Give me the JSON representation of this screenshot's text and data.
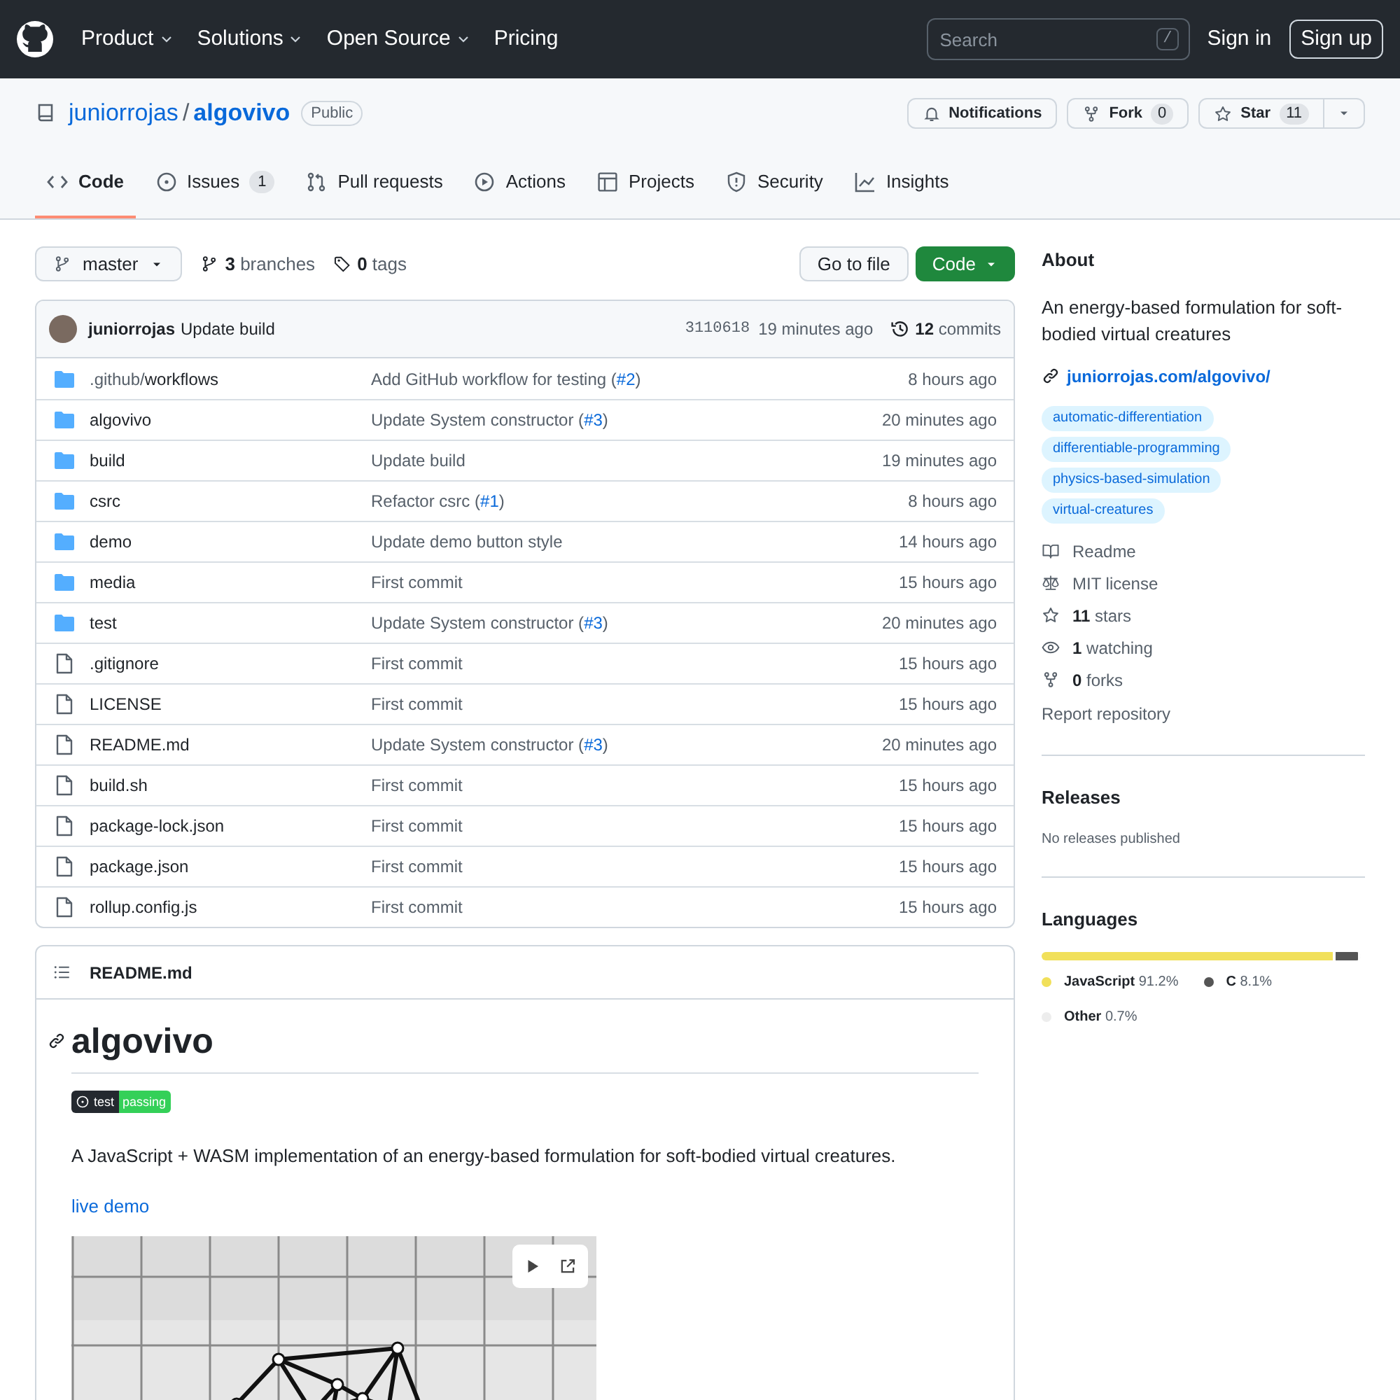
{
  "header": {
    "nav": [
      {
        "label": "Product",
        "caret": true
      },
      {
        "label": "Solutions",
        "caret": true
      },
      {
        "label": "Open Source",
        "caret": true
      },
      {
        "label": "Pricing",
        "caret": false
      }
    ],
    "search": {
      "placeholder": "Search",
      "shortcut": "/"
    },
    "sign_in": "Sign in",
    "sign_up": "Sign up"
  },
  "repo": {
    "owner": "juniorrojas",
    "separator": "/",
    "name": "algovivo",
    "visibility": "Public",
    "notifications": "Notifications",
    "fork": {
      "label": "Fork",
      "count": "0"
    },
    "star": {
      "label": "Star",
      "count": "11"
    }
  },
  "tabs": [
    {
      "kind": "code",
      "label": "Code",
      "selected": true
    },
    {
      "kind": "issues",
      "label": "Issues",
      "count": "1",
      "selected": false
    },
    {
      "kind": "pulls",
      "label": "Pull requests",
      "selected": false
    },
    {
      "kind": "actions",
      "label": "Actions",
      "selected": false
    },
    {
      "kind": "projects",
      "label": "Projects",
      "selected": false
    },
    {
      "kind": "security",
      "label": "Security",
      "selected": false
    },
    {
      "kind": "insights",
      "label": "Insights",
      "selected": false
    }
  ],
  "toolbar": {
    "branch": "master",
    "branches_count": "3",
    "branches_label": "branches",
    "tags_count": "0",
    "tags_label": "tags",
    "go_to_file": "Go to file",
    "code": "Code"
  },
  "latest_commit": {
    "author": "juniorrojas",
    "message": "Update build",
    "sha": "3110618",
    "time": "19 minutes ago",
    "commits_count": "12",
    "commits_label": "commits"
  },
  "files": [
    {
      "kind": "dir",
      "name_prefix": ".github/",
      "name": "workflows",
      "message": [
        {
          "kind": "text",
          "text": "Add GitHub workflow for testing ("
        },
        {
          "kind": "link",
          "text": "#2"
        },
        {
          "kind": "text",
          "text": ")"
        }
      ],
      "time": "8 hours ago"
    },
    {
      "kind": "dir",
      "name": "algovivo",
      "message": [
        {
          "kind": "text",
          "text": "Update System constructor ("
        },
        {
          "kind": "link",
          "text": "#3"
        },
        {
          "kind": "text",
          "text": ")"
        }
      ],
      "time": "20 minutes ago"
    },
    {
      "kind": "dir",
      "name": "build",
      "message": [
        {
          "kind": "text",
          "text": "Update build"
        }
      ],
      "time": "19 minutes ago"
    },
    {
      "kind": "dir",
      "name": "csrc",
      "message": [
        {
          "kind": "text",
          "text": "Refactor csrc ("
        },
        {
          "kind": "link",
          "text": "#1"
        },
        {
          "kind": "text",
          "text": ")"
        }
      ],
      "time": "8 hours ago"
    },
    {
      "kind": "dir",
      "name": "demo",
      "message": [
        {
          "kind": "text",
          "text": "Update demo button style"
        }
      ],
      "time": "14 hours ago"
    },
    {
      "kind": "dir",
      "name": "media",
      "message": [
        {
          "kind": "text",
          "text": "First commit"
        }
      ],
      "time": "15 hours ago"
    },
    {
      "kind": "dir",
      "name": "test",
      "message": [
        {
          "kind": "text",
          "text": "Update System constructor ("
        },
        {
          "kind": "link",
          "text": "#3"
        },
        {
          "kind": "text",
          "text": ")"
        }
      ],
      "time": "20 minutes ago"
    },
    {
      "kind": "file",
      "name": ".gitignore",
      "message": [
        {
          "kind": "text",
          "text": "First commit"
        }
      ],
      "time": "15 hours ago"
    },
    {
      "kind": "file",
      "name": "LICENSE",
      "message": [
        {
          "kind": "text",
          "text": "First commit"
        }
      ],
      "time": "15 hours ago"
    },
    {
      "kind": "file",
      "name": "README.md",
      "message": [
        {
          "kind": "text",
          "text": "Update System constructor ("
        },
        {
          "kind": "link",
          "text": "#3"
        },
        {
          "kind": "text",
          "text": ")"
        }
      ],
      "time": "20 minutes ago"
    },
    {
      "kind": "file",
      "name": "build.sh",
      "message": [
        {
          "kind": "text",
          "text": "First commit"
        }
      ],
      "time": "15 hours ago"
    },
    {
      "kind": "file",
      "name": "package-lock.json",
      "message": [
        {
          "kind": "text",
          "text": "First commit"
        }
      ],
      "time": "15 hours ago"
    },
    {
      "kind": "file",
      "name": "package.json",
      "message": [
        {
          "kind": "text",
          "text": "First commit"
        }
      ],
      "time": "15 hours ago"
    },
    {
      "kind": "file",
      "name": "rollup.config.js",
      "message": [
        {
          "kind": "text",
          "text": "First commit"
        }
      ],
      "time": "15 hours ago"
    }
  ],
  "readme": {
    "filename": "README.md",
    "title": "algovivo",
    "badge": {
      "label": "test",
      "status": "passing"
    },
    "description": "A JavaScript + WASM implementation of an energy-based formulation for soft-bodied virtual creatures.",
    "link": "live demo"
  },
  "about": {
    "title": "About",
    "description": "An energy-based formulation for soft-bodied virtual creatures",
    "website": "juniorrojas.com/algovivo/",
    "topics": [
      "automatic-differentiation",
      "differentiable-programming",
      "physics-based-simulation",
      "virtual-creatures"
    ],
    "meta": [
      {
        "kind": "readme",
        "label": "Readme"
      },
      {
        "kind": "license",
        "label": "MIT license"
      },
      {
        "kind": "stars",
        "count": "11",
        "label": "stars"
      },
      {
        "kind": "watching",
        "count": "1",
        "label": "watching"
      },
      {
        "kind": "forks",
        "count": "0",
        "label": "forks"
      }
    ],
    "report": "Report repository"
  },
  "releases": {
    "title": "Releases",
    "note": "No releases published"
  },
  "languages": {
    "title": "Languages",
    "items": [
      {
        "name": "JavaScript",
        "percent": "91.2%",
        "color": "#f1e05a"
      },
      {
        "name": "C",
        "percent": "8.1%",
        "color": "#555555"
      },
      {
        "name": "Other",
        "percent": "0.7%",
        "color": "#ededed"
      }
    ]
  }
}
